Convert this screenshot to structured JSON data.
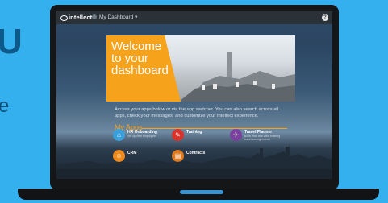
{
  "topbar": {
    "logo_text": "intellect",
    "dashboard_label": "My Dashboard ▾",
    "help_icon": "question-icon"
  },
  "hero": {
    "title_line1": "Welcome",
    "title_line2": "to your",
    "title_line3": "dashboard"
  },
  "intro_text": "Access your apps below or via the app switcher. You can also search across all apps, check your messages, and customize your Intellect experience.",
  "apps_heading": "My Apps",
  "apps": [
    {
      "name": "HR Onboarding",
      "desc": "Set up new employees",
      "color": "#3aa0dc",
      "icon": "home-icon"
    },
    {
      "name": "Training",
      "desc": "",
      "color": "#d9322b",
      "icon": "clipboard-icon"
    },
    {
      "name": "Travel Planner",
      "desc": "Book new and view existing travel arrangements",
      "color": "#7b3fa0",
      "icon": "airplane-icon"
    },
    {
      "name": "CRM",
      "desc": "",
      "color": "#f08a1c",
      "icon": "users-icon"
    },
    {
      "name": "Contracts",
      "desc": "",
      "color": "#e07a1f",
      "icon": "document-icon"
    }
  ],
  "colors": {
    "accent": "#f7a21b",
    "background": "#35b0ee"
  }
}
